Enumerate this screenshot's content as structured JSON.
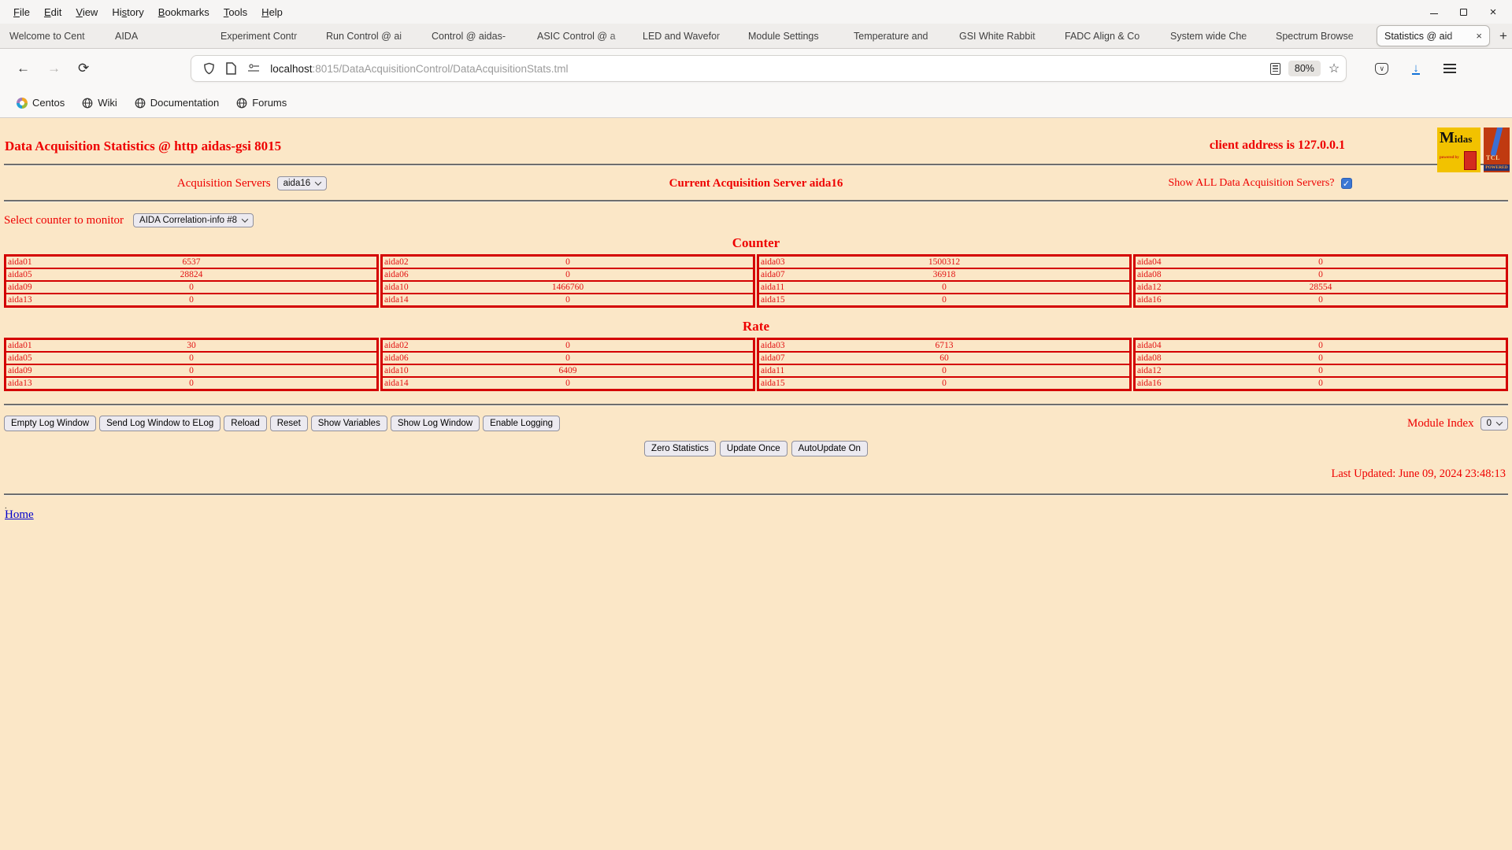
{
  "browser": {
    "menu": [
      {
        "label": "File",
        "u": 0
      },
      {
        "label": "Edit",
        "u": 0
      },
      {
        "label": "View",
        "u": 0
      },
      {
        "label": "History",
        "u": 2
      },
      {
        "label": "Bookmarks",
        "u": 0
      },
      {
        "label": "Tools",
        "u": 0
      },
      {
        "label": "Help",
        "u": 0
      }
    ],
    "tabs": [
      {
        "label": "Welcome to Cent",
        "active": false
      },
      {
        "label": "AIDA",
        "active": false
      },
      {
        "label": "Experiment Contr",
        "active": false
      },
      {
        "label": "Run Control @ ai",
        "active": false
      },
      {
        "label": "Control @ aidas-",
        "active": false
      },
      {
        "label": "ASIC Control @ a",
        "active": false
      },
      {
        "label": "LED and Wavefor",
        "active": false
      },
      {
        "label": "Module Settings",
        "active": false
      },
      {
        "label": "Temperature and",
        "active": false
      },
      {
        "label": "GSI White Rabbit",
        "active": false
      },
      {
        "label": "FADC Align & Co",
        "active": false
      },
      {
        "label": "System wide Che",
        "active": false
      },
      {
        "label": "Spectrum Browse",
        "active": false
      },
      {
        "label": "Statistics @ aid",
        "active": true
      }
    ],
    "new_tab_button": "+",
    "window_controls": {
      "close": "×"
    },
    "nav": {
      "url_host": "localhost",
      "url_path": ":8015/DataAcquisitionControl/DataAcquisitionStats.tml",
      "zoom_badge": "80%"
    },
    "bookmarks": [
      {
        "label": "Centos",
        "icon": "centos-icon"
      },
      {
        "label": "Wiki",
        "icon": "globe-icon"
      },
      {
        "label": "Documentation",
        "icon": "globe-icon"
      },
      {
        "label": "Forums",
        "icon": "globe-icon"
      }
    ]
  },
  "icons": {
    "star": "☆",
    "pocket_v": "∨",
    "back": "←",
    "forward": "→",
    "reload": "⟳",
    "download": "↓",
    "check": "✓",
    "close": "×"
  },
  "page": {
    "title": "Data Acquisition Statistics @ http aidas-gsi 8015",
    "client_address": "client address is 127.0.0.1",
    "logos": {
      "midas_m": "M",
      "midas_rest": "idas",
      "midas_powered": "powered by",
      "tcl_text": "TCL",
      "tcl_powered": "POWERED"
    },
    "server_row": {
      "label": "Acquisition Servers",
      "selected": "aida16",
      "current": "Current Acquisition Server aida16",
      "show_all_label": "Show ALL Data Acquisition Servers?",
      "show_all_checked": true
    },
    "counter_select": {
      "label": "Select counter to monitor",
      "selected": "AIDA Correlation-info #8"
    },
    "sections": [
      {
        "heading": "Counter",
        "rows": [
          [
            {
              "label": "aida01",
              "value": "6537"
            },
            {
              "label": "aida02",
              "value": "0"
            },
            {
              "label": "aida03",
              "value": "1500312"
            },
            {
              "label": "aida04",
              "value": "0"
            }
          ],
          [
            {
              "label": "aida05",
              "value": "28824"
            },
            {
              "label": "aida06",
              "value": "0"
            },
            {
              "label": "aida07",
              "value": "36918"
            },
            {
              "label": "aida08",
              "value": "0"
            }
          ],
          [
            {
              "label": "aida09",
              "value": "0"
            },
            {
              "label": "aida10",
              "value": "1466760"
            },
            {
              "label": "aida11",
              "value": "0"
            },
            {
              "label": "aida12",
              "value": "28554"
            }
          ],
          [
            {
              "label": "aida13",
              "value": "0"
            },
            {
              "label": "aida14",
              "value": "0"
            },
            {
              "label": "aida15",
              "value": "0"
            },
            {
              "label": "aida16",
              "value": "0"
            }
          ]
        ]
      },
      {
        "heading": "Rate",
        "rows": [
          [
            {
              "label": "aida01",
              "value": "30"
            },
            {
              "label": "aida02",
              "value": "0"
            },
            {
              "label": "aida03",
              "value": "6713"
            },
            {
              "label": "aida04",
              "value": "0"
            }
          ],
          [
            {
              "label": "aida05",
              "value": "0"
            },
            {
              "label": "aida06",
              "value": "0"
            },
            {
              "label": "aida07",
              "value": "60"
            },
            {
              "label": "aida08",
              "value": "0"
            }
          ],
          [
            {
              "label": "aida09",
              "value": "0"
            },
            {
              "label": "aida10",
              "value": "6409"
            },
            {
              "label": "aida11",
              "value": "0"
            },
            {
              "label": "aida12",
              "value": "0"
            }
          ],
          [
            {
              "label": "aida13",
              "value": "0"
            },
            {
              "label": "aida14",
              "value": "0"
            },
            {
              "label": "aida15",
              "value": "0"
            },
            {
              "label": "aida16",
              "value": "0"
            }
          ]
        ]
      }
    ],
    "log_buttons": [
      "Empty Log Window",
      "Send Log Window to ELog",
      "Reload",
      "Reset",
      "Show Variables",
      "Show Log Window",
      "Enable Logging"
    ],
    "module_index": {
      "label": "Module Index",
      "selected": "0"
    },
    "update_buttons": [
      "Zero Statistics",
      "Update Once",
      "AutoUpdate On"
    ],
    "last_updated": "Last Updated: June 09, 2024 23:48:13",
    "footer": {
      "dot": ".",
      "home": "Home"
    }
  },
  "colors": {
    "page_bg": "#fbe7c7",
    "accent_red": "#ee0000",
    "table_border": "#d40000",
    "link_blue": "#0000cc",
    "checkbox_blue": "#3a77d4",
    "download_blue": "#1172d8"
  }
}
